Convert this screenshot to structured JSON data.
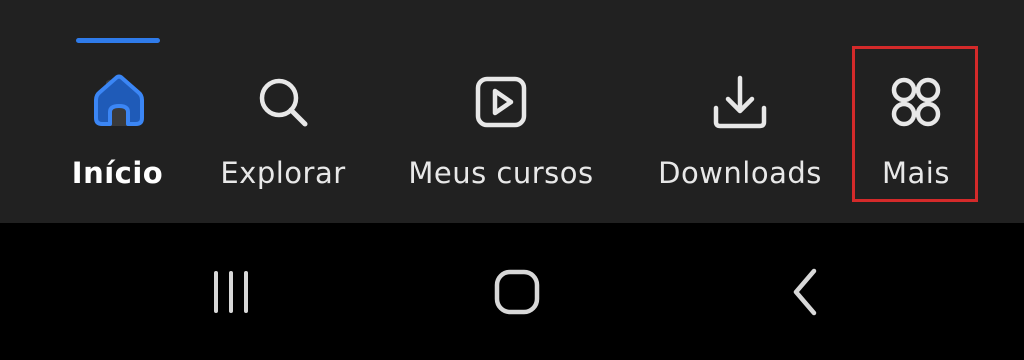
{
  "bottom_nav": {
    "accent_color": "#2f7bea",
    "background": "#212121",
    "items": [
      {
        "label": "Início",
        "icon": "home-icon",
        "active": true
      },
      {
        "label": "Explorar",
        "icon": "search-icon",
        "active": false
      },
      {
        "label": "Meus cursos",
        "icon": "play-icon",
        "active": false
      },
      {
        "label": "Downloads",
        "icon": "download-icon",
        "active": false
      },
      {
        "label": "Mais",
        "icon": "grid-icon",
        "active": false,
        "highlighted": true
      }
    ],
    "highlight_color": "#d42a2a"
  },
  "system_nav": {
    "buttons": [
      {
        "icon": "recents-icon"
      },
      {
        "icon": "home-circle-icon"
      },
      {
        "icon": "back-icon"
      }
    ]
  }
}
